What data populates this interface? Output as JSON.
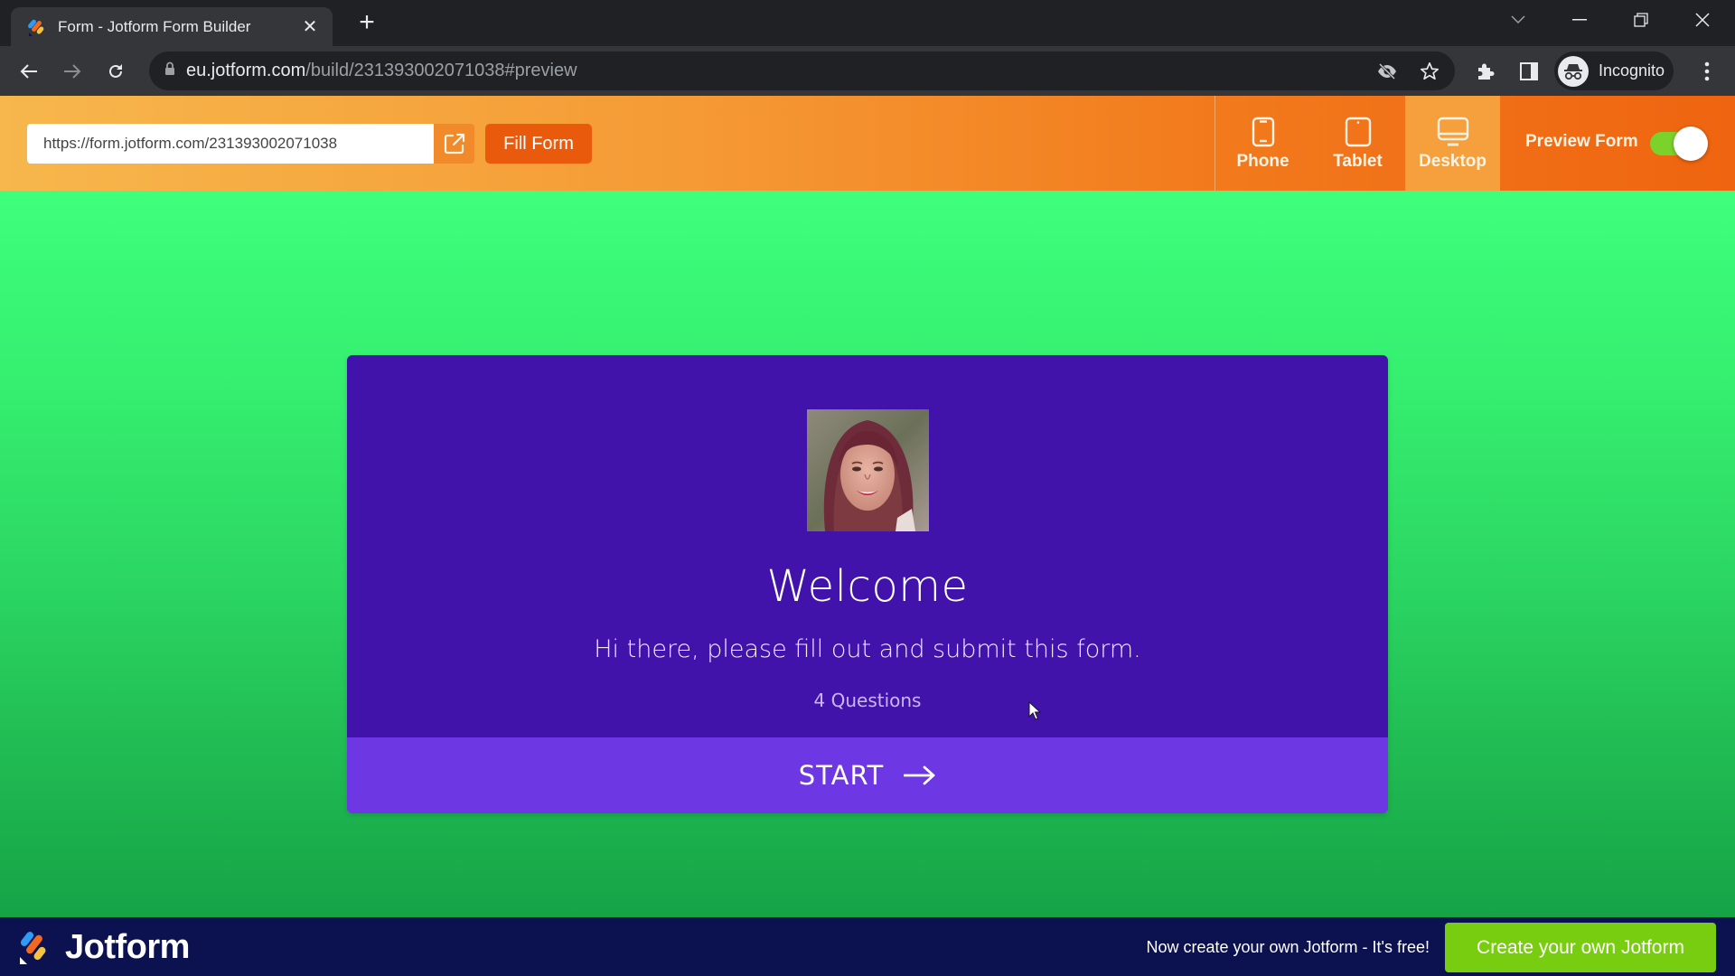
{
  "browser": {
    "tab_title": "Form - Jotform Form Builder",
    "url_host": "eu.jotform.com",
    "url_path": "/build/231393002071038#preview",
    "profile_label": "Incognito"
  },
  "header": {
    "form_url": "https://form.jotform.com/231393002071038",
    "fill_form_label": "Fill Form",
    "devices": [
      {
        "label": "Phone",
        "icon": "phone-icon",
        "active": false
      },
      {
        "label": "Tablet",
        "icon": "tablet-icon",
        "active": false
      },
      {
        "label": "Desktop",
        "icon": "desktop-icon",
        "active": true
      }
    ],
    "preview_label": "Preview Form",
    "preview_enabled": true
  },
  "form": {
    "title": "Welcome",
    "subtitle": "Hi there, please fill out and submit this form.",
    "question_count": "4 Questions",
    "start_label": "START",
    "colors": {
      "card_bg": "#4213ab",
      "start_bg": "#6d38e4",
      "page_bg_top": "#3eff7c",
      "page_bg_bottom": "#16a347"
    }
  },
  "footer": {
    "brand": "Jotform",
    "promo_text": "Now create your own Jotform - It's free!",
    "cta_label": "Create your own Jotform"
  }
}
